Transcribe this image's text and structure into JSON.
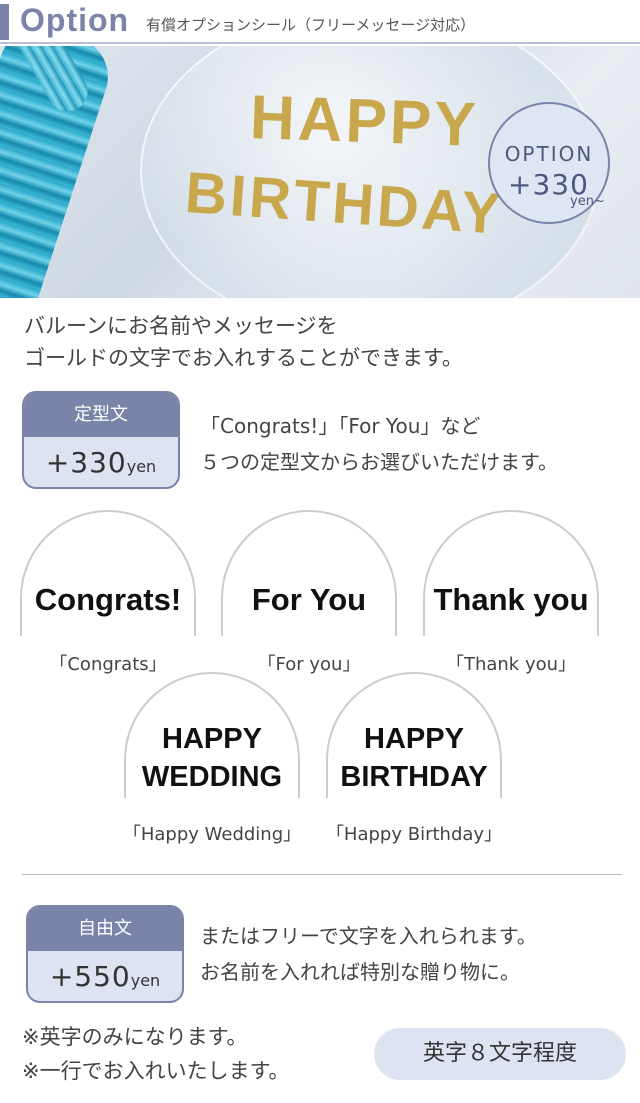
{
  "header": {
    "title": "Option",
    "subtitle": "有償オプションシール（フリーメッセージ対応）"
  },
  "hero": {
    "line1": "HAPPY",
    "line2": "BIRTHDAY",
    "badge_option": "OPTION",
    "badge_price": "+330",
    "badge_unit": "yen~"
  },
  "intro": {
    "line1": "バルーンにお名前やメッセージを",
    "line2": "ゴールドの文字でお入れすることができます。"
  },
  "fixed_text": {
    "tag_label": "定型文",
    "price": "+330",
    "unit": "yen",
    "desc_line1": "「Congrats!」「For You」など",
    "desc_line2": "５つの定型文からお選びいただけます。"
  },
  "samples": [
    {
      "label": "Congrats!",
      "caption": "「Congrats」"
    },
    {
      "label": "For You",
      "caption": "「For you」"
    },
    {
      "label": "Thank you",
      "caption": "「Thank you」"
    },
    {
      "label_line1": "HAPPY",
      "label_line2": "WEDDING",
      "caption": "「Happy Wedding」"
    },
    {
      "label_line1": "HAPPY",
      "label_line2": "BIRTHDAY",
      "caption": "「Happy Birthday」"
    }
  ],
  "free_text": {
    "tag_label": "自由文",
    "price": "+550",
    "unit": "yen",
    "desc_line1": "またはフリーで文字を入れられます。",
    "desc_line2": "お名前を入れれば特別な贈り物に。"
  },
  "notes": {
    "line1": "※英字のみになります。",
    "line2": "※一行でお入れいたします。",
    "limit": "英字８文字程度"
  },
  "colors": {
    "accent": "#7a83a8",
    "accent_light": "#dde3f1",
    "gold": "#c9a74d"
  }
}
